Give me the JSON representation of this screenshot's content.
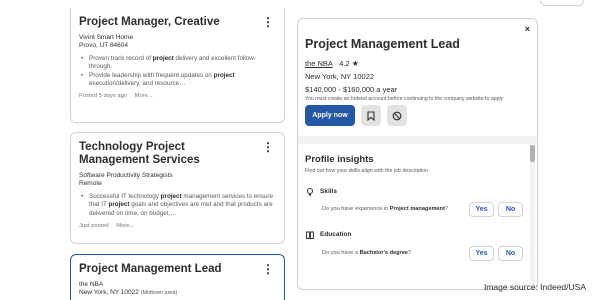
{
  "jobs": [
    {
      "title": "Project Manager, Creative",
      "company": "Vivint Smart Home",
      "location": "Provo, UT 84604",
      "bullets": [
        {
          "pre": "Proven track record of ",
          "bold": "project",
          "post": " delivery and excellent follow-through."
        },
        {
          "pre": "Provide leadership with frequent updates on ",
          "bold": "project",
          "post": " execution/delivery, and resource…"
        }
      ],
      "posted": "Posted 5 days ago",
      "more": "More..."
    },
    {
      "title": "Technology Project Management Services",
      "company": "Software Productivity Strategists",
      "location": "Remote",
      "bullets": [
        {
          "pre": "Successful IT technology ",
          "bold": "project",
          "post": " management services to ensure that IT "
        },
        {
          "pre": "",
          "bold": "project",
          "post": " goals and objectives are met and that products are delivered on time, on budget,…"
        }
      ],
      "posted": "Just posted",
      "more": "More..."
    },
    {
      "title": "Project Management Lead",
      "company": "the NBA",
      "location": "New York, NY 10022",
      "area": "(Midtown area)"
    }
  ],
  "detail": {
    "title": "Project Management Lead",
    "company": "the NBA",
    "rating": "4.2",
    "location": "New York, NY 10022",
    "salary": "$140,000 - $160,000 a year",
    "note": "You must create an Indeed account before continuing to the company website to apply",
    "apply_label": "Apply now",
    "close_label": "×",
    "insights_title": "Profile insights",
    "insights_sub": "Find out how your skills align with the job description",
    "skills_label": "Skills",
    "skills_q_pre": "Do you have experience in ",
    "skills_q_bold": "Project management",
    "skills_q_post": "?",
    "education_label": "Education",
    "edu_q_pre": "Do you have a ",
    "edu_q_bold": "Bachelor's degree",
    "edu_q_post": "?",
    "yes_label": "Yes",
    "no_label": "No"
  },
  "caption": "Image source: Indeed/USA",
  "colors": {
    "accent": "#2557a7",
    "text": "#2d2d2d",
    "muted": "#595959",
    "border": "#d4d2d0"
  },
  "icons": [
    "kebab-menu-icon",
    "close-icon",
    "star-icon",
    "bookmark-icon",
    "not-interested-icon",
    "lightbulb-icon",
    "education-book-icon"
  ]
}
